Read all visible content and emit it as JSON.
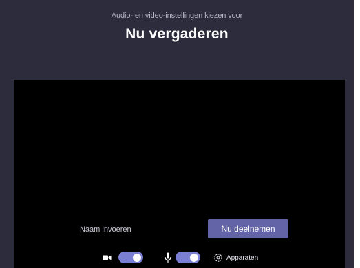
{
  "header": {
    "subtitle": "Audio- en video-instellingen kiezen voor",
    "title": "Nu vergaderen"
  },
  "join": {
    "name_placeholder": "Naam invoeren",
    "join_label": "Nu deelnemen"
  },
  "controls": {
    "camera_icon": "video-camera-icon",
    "camera_toggle_on": true,
    "mic_icon": "microphone-icon",
    "mic_toggle_on": true,
    "devices_icon": "gear-icon",
    "devices_label": "Apparaten"
  },
  "colors": {
    "background": "#2D2C3C",
    "video_area": "#000000",
    "accent": "#6264A7",
    "toggle_on": "#7B7FD3"
  }
}
